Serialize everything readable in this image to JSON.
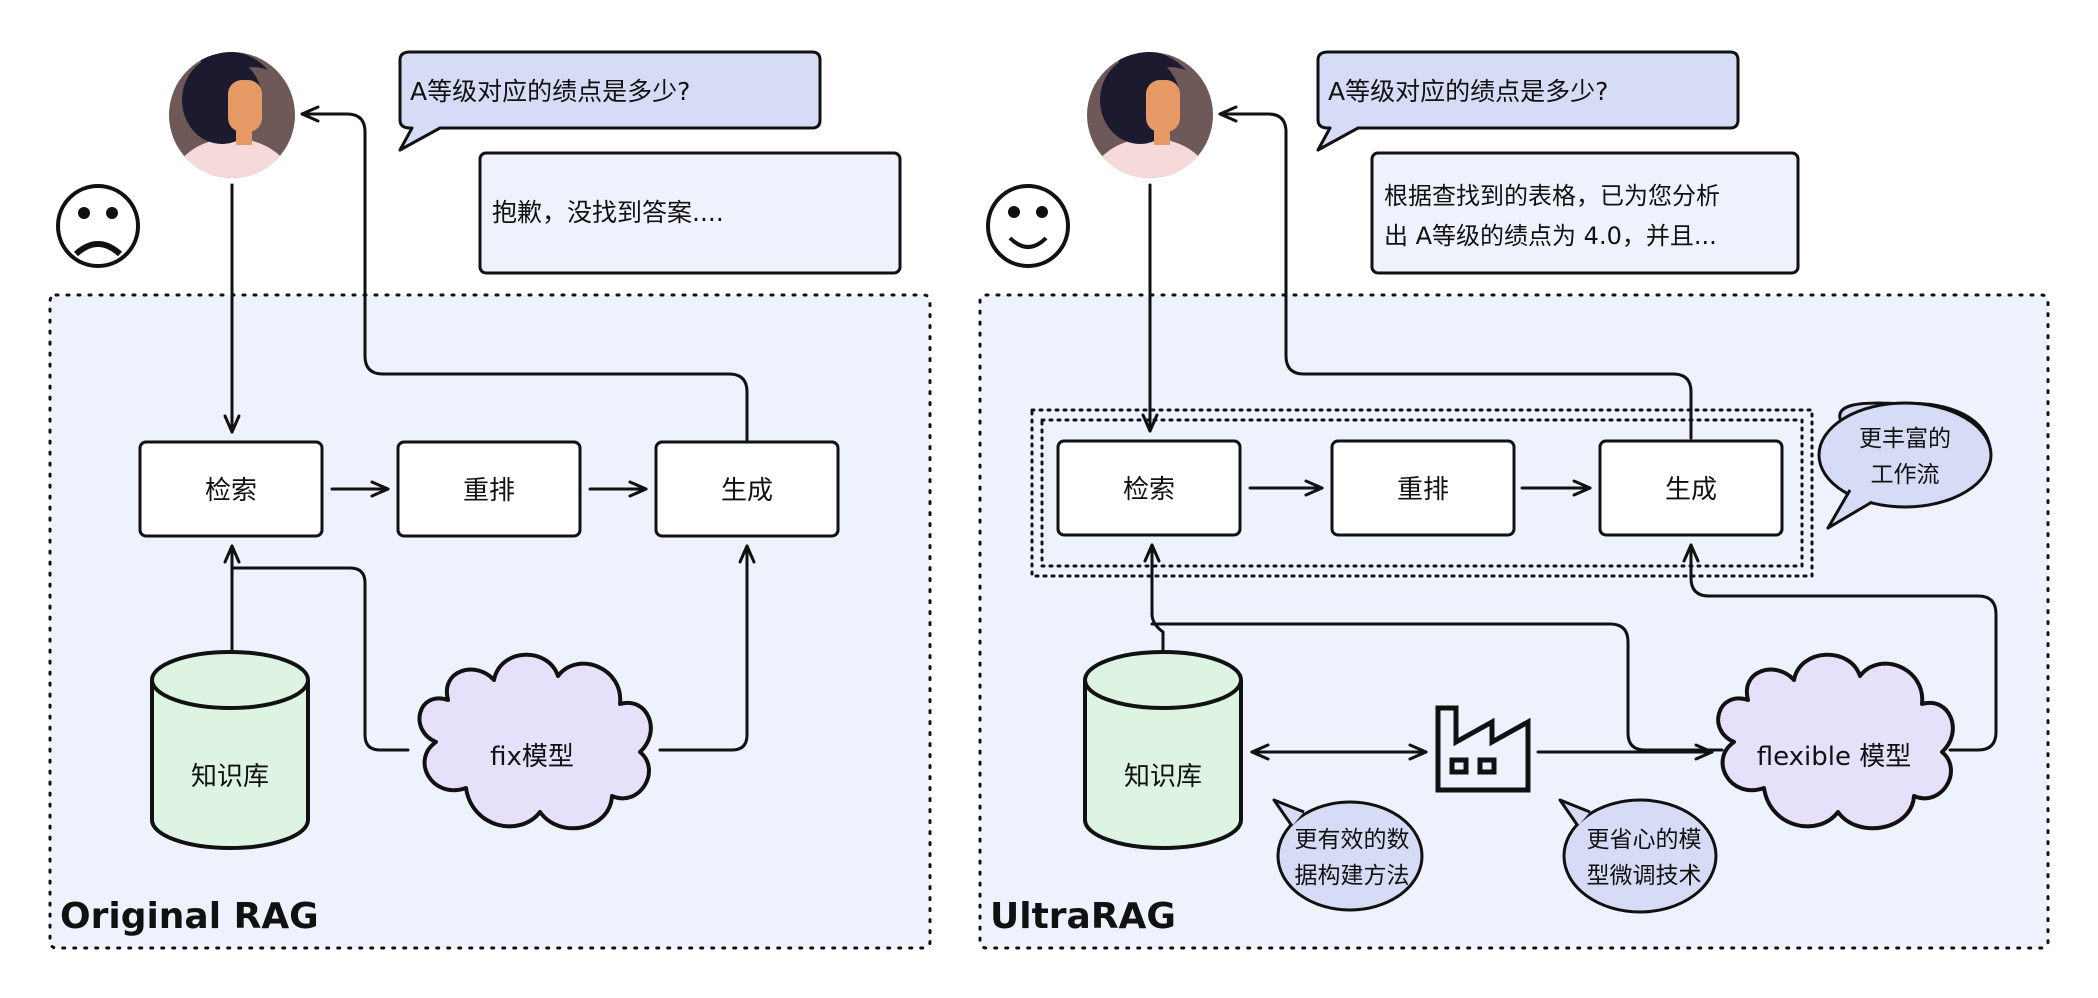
{
  "left": {
    "title": "Original RAG",
    "question": "A等级对应的绩点是多少?",
    "answer": "抱歉，没找到答案....",
    "steps": {
      "retrieve": "检索",
      "rerank": "重排",
      "generate": "生成"
    },
    "kb": "知识库",
    "model": "fix模型"
  },
  "right": {
    "title": "UltraRAG",
    "question": "A等级对应的绩点是多少?",
    "answer_line1": "根据查找到的表格，已为您分析",
    "answer_line2": "出 A等级的绩点为 4.0，并且...",
    "steps": {
      "retrieve": "检索",
      "rerank": "重排",
      "generate": "生成"
    },
    "kb": "知识库",
    "model": "flexible 模型",
    "bubble_workflow": {
      "line1": "更丰富的",
      "line2": "工作流"
    },
    "bubble_data": {
      "line1": "更有效的数",
      "line2": "据构建方法"
    },
    "bubble_tuning": {
      "line1": "更省心的模",
      "line2": "型微调技术"
    }
  },
  "colors": {
    "panel_bg": "#eef2fc",
    "question_bubble": "#d6dcf6",
    "answer_box": "#eef2fc",
    "kb_fill": "#ddf4e3",
    "cloud_fill": "#e6e0fa",
    "feature_bubble": "#d6dcf6"
  },
  "icons": [
    "user-avatar-icon",
    "sad-face-icon",
    "smiley-face-icon",
    "factory-icon"
  ]
}
